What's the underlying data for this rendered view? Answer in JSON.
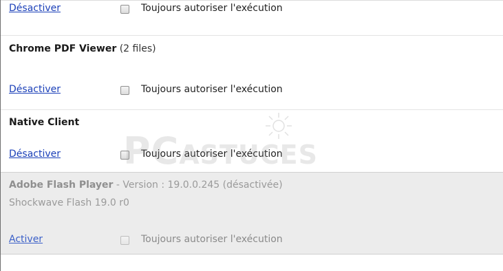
{
  "plugins": [
    {
      "name": "",
      "suffix": "",
      "action_label": "Désactiver",
      "checkbox_label": "Toujours autoriser l'exécution",
      "disabled": false
    },
    {
      "name": "Chrome PDF Viewer",
      "suffix": " (2 files)",
      "action_label": "Désactiver",
      "checkbox_label": "Toujours autoriser l'exécution",
      "disabled": false
    },
    {
      "name": "Native Client",
      "suffix": "",
      "action_label": "Désactiver",
      "checkbox_label": "Toujours autoriser l'exécution",
      "disabled": false
    },
    {
      "name": "Adobe Flash Player",
      "suffix": " - Version : 19.0.0.245 (désactivée)",
      "subline": "Shockwave Flash 19.0 r0",
      "action_label": "Activer",
      "checkbox_label": "Toujours autoriser l'exécution",
      "disabled": true
    }
  ],
  "watermark": {
    "big": "PC",
    "small": "ASTUCES"
  }
}
